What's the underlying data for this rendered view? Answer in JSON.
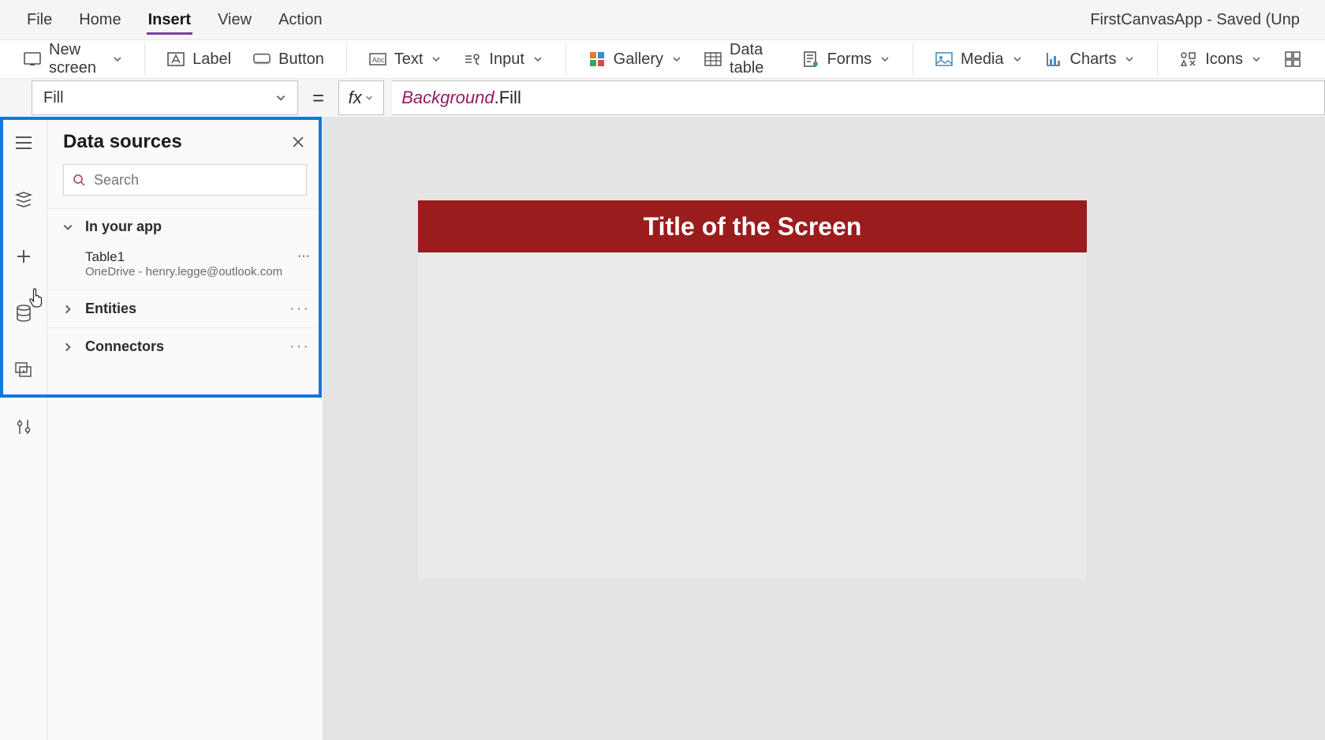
{
  "window_title": "FirstCanvasApp - Saved (Unp",
  "menubar": {
    "items": [
      "File",
      "Home",
      "Insert",
      "View",
      "Action"
    ],
    "active_index": 2
  },
  "ribbon": {
    "new_screen": "New screen",
    "label": "Label",
    "button": "Button",
    "text": "Text",
    "input": "Input",
    "gallery": "Gallery",
    "data_table": "Data table",
    "forms": "Forms",
    "media": "Media",
    "charts": "Charts",
    "icons": "Icons"
  },
  "formula": {
    "property": "Fill",
    "obj": "Background",
    "prop": "Fill"
  },
  "panel": {
    "title": "Data sources",
    "search_placeholder": "Search",
    "sections": {
      "in_your_app": "In your app",
      "entities": "Entities",
      "connectors": "Connectors"
    },
    "datasource": {
      "name": "Table1",
      "sub": "OneDrive - henry.legge@outlook.com"
    }
  },
  "canvas": {
    "title": "Title of the Screen"
  }
}
